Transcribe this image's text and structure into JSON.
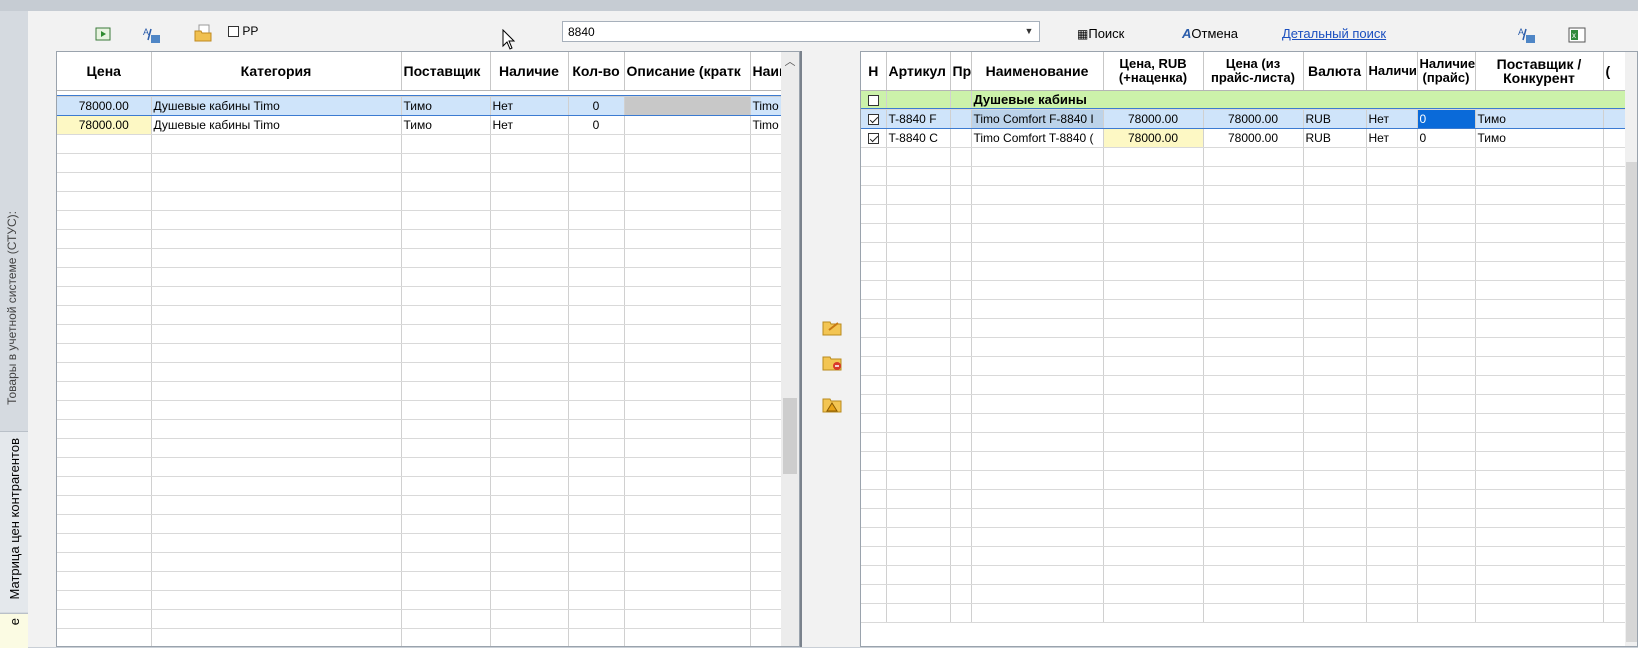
{
  "sidebar": {
    "vertical_title": "Товары в учетной системе (СТУС):",
    "tabs": [
      {
        "label": "Матрица цен контрагентов"
      },
      {
        "label": "е"
      }
    ]
  },
  "toolbar": {
    "pp_label": "РР",
    "pp_checked": false,
    "search_value": "8840",
    "search_button": "Поиск",
    "cancel_button": "Отмена",
    "detail_search_link": "Детальный поиск"
  },
  "left_table": {
    "columns": [
      "Цена",
      "Категория",
      "Поставщик",
      "Наличие",
      "Кол-во",
      "Описание (кратк",
      "Наим"
    ],
    "rows": [
      {
        "price": "78000.00",
        "category": "Душевые кабины Timo",
        "supplier": "Тимо",
        "stock": "Нет",
        "qty": "0",
        "desc": "",
        "name": "Timo"
      },
      {
        "price": "78000.00",
        "category": "Душевые кабины Timo",
        "supplier": "Тимо",
        "stock": "Нет",
        "qty": "0",
        "desc": "",
        "name": "Timo"
      }
    ]
  },
  "right_table": {
    "columns": [
      "Н",
      "Артикул",
      "Пр",
      "Наименование",
      "Цена, RUB\n(+наценка)",
      "Цена (из\nпрайс-листа)",
      "Валюта",
      "Наличие",
      "Наличие\n(прайс)",
      "Поставщик /\nКонкурент",
      "("
    ],
    "group_row": {
      "label": "Душевые кабины"
    },
    "rows": [
      {
        "checked": true,
        "article": "T-8840 F",
        "pr": "",
        "name": "Timo Comfort F-8840 I",
        "price_markup": "78000.00",
        "price_list": "78000.00",
        "currency": "RUB",
        "stock": "Нет",
        "stock_price": "0",
        "supplier": "Тимо"
      },
      {
        "checked": true,
        "article": "T-8840 C",
        "pr": "",
        "name": "Timo Comfort T-8840 (",
        "price_markup": "78000.00",
        "price_list": "78000.00",
        "currency": "RUB",
        "stock": "Нет",
        "stock_price": "0",
        "supplier": "Тимо"
      }
    ]
  },
  "colors": {
    "selection": "#cfe4fa",
    "yellow": "#fdf8c4",
    "group": "#ccf2aa",
    "active_cell": "#0a6ad9",
    "link": "#1a4fbf"
  }
}
